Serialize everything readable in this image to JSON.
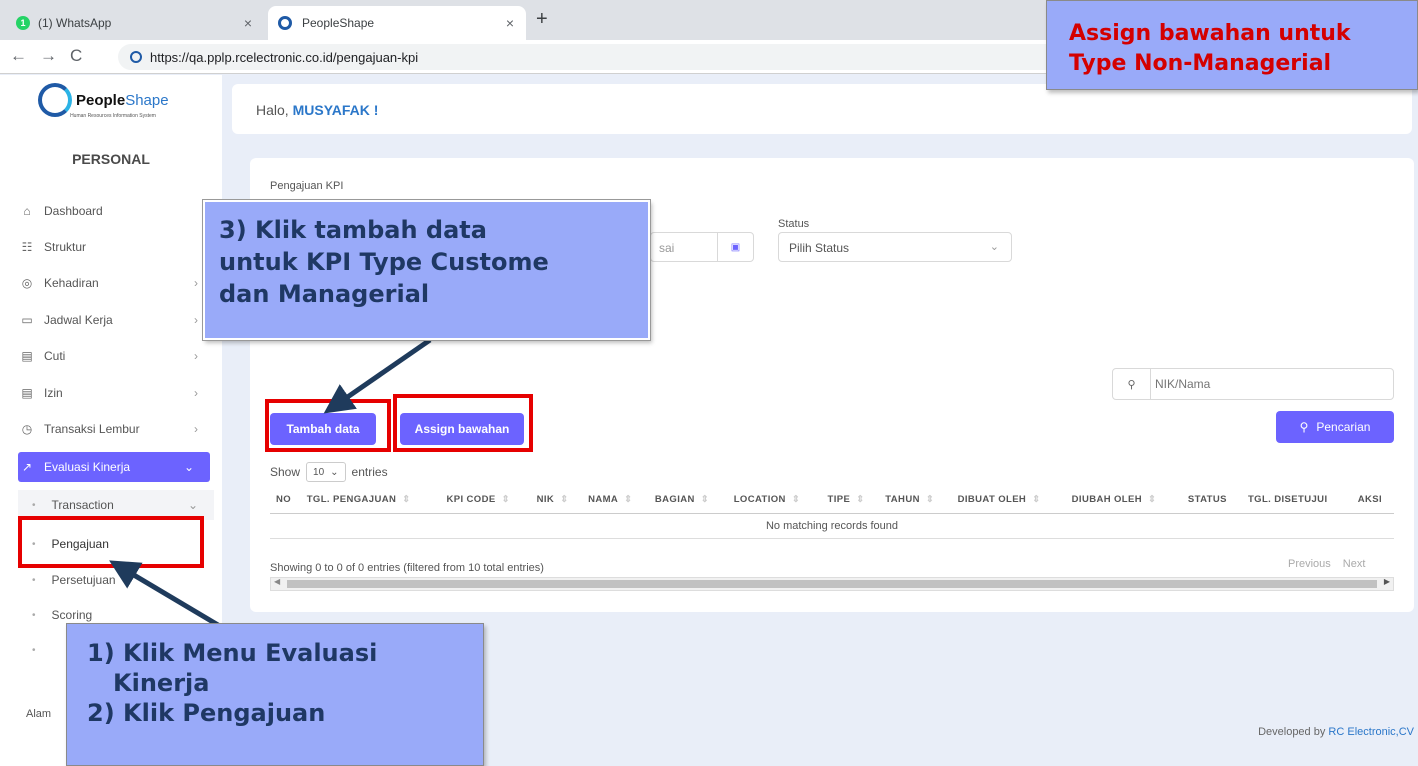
{
  "browser": {
    "tabs": [
      {
        "badge": "1",
        "label": "(1) WhatsApp"
      },
      {
        "label": "PeopleShape"
      }
    ],
    "new_tab": "+",
    "close": "×",
    "url": "https://qa.pplp.rcelectronic.co.id/pengajuan-kpi"
  },
  "brand": {
    "name_bold": "People",
    "name_light": "Shape",
    "tagline": "Human Resources Information System"
  },
  "sidebar": {
    "section": "PERSONAL",
    "items": [
      {
        "label": "Dashboard",
        "icon": "home-icon"
      },
      {
        "label": "Struktur",
        "icon": "org-chart-icon"
      },
      {
        "label": "Kehadiran",
        "icon": "fingerprint-icon"
      },
      {
        "label": "Jadwal Kerja",
        "icon": "briefcase-icon"
      },
      {
        "label": "Cuti",
        "icon": "calendar-icon"
      },
      {
        "label": "Izin",
        "icon": "calendar-icon"
      },
      {
        "label": "Transaksi Lembur",
        "icon": "clock-icon"
      },
      {
        "label": "Evaluasi Kinerja",
        "icon": "chart-line-icon"
      }
    ],
    "sub_transaction": "Transaction",
    "sub_items": [
      "Pengajuan",
      "Persetujuan",
      "Scoring"
    ],
    "footer_text": "Alam"
  },
  "header": {
    "greeting": "Halo,",
    "user": "MUSYAFAK !"
  },
  "page": {
    "title": "Pengajuan KPI",
    "date_partial": "sai",
    "status_label": "Status",
    "status_value": "Pilih Status",
    "search_placeholder": "NIK/Nama",
    "buttons": {
      "tambah": "Tambah data",
      "assign": "Assign bawahan",
      "cari": "Pencarian"
    },
    "show": "Show",
    "entries_value": "10",
    "entries": "entries",
    "table": {
      "columns": [
        "NO",
        "TGL. PENGAJUAN",
        "KPI CODE",
        "NIK",
        "NAMA",
        "BAGIAN",
        "LOCATION",
        "TIPE",
        "TAHUN",
        "DIBUAT OLEH",
        "DIUBAH OLEH",
        "STATUS",
        "TGL. DISETUJUI",
        "AKSI"
      ],
      "empty": "No matching records found"
    },
    "info": "Showing 0 to 0 of 0 entries (filtered from 10 total entries)",
    "pager": {
      "prev": "Previous",
      "next": "Next"
    }
  },
  "footer": {
    "prefix": "Developed by",
    "company": "RC Electronic,CV"
  },
  "annotations": {
    "step3_lines": [
      "3) Klik tambah data",
      "untuk KPI Type Custome",
      "dan Managerial"
    ],
    "step12_lines": [
      "1) Klik Menu Evaluasi",
      "Kinerja",
      "2) Klik Pengajuan"
    ],
    "top_lines": [
      "Assign bawahan untuk",
      "Type Non-Managerial"
    ],
    "highlight_color": "#e60000",
    "callout_color": "#99aaf9",
    "accent": "#6c63ff"
  }
}
